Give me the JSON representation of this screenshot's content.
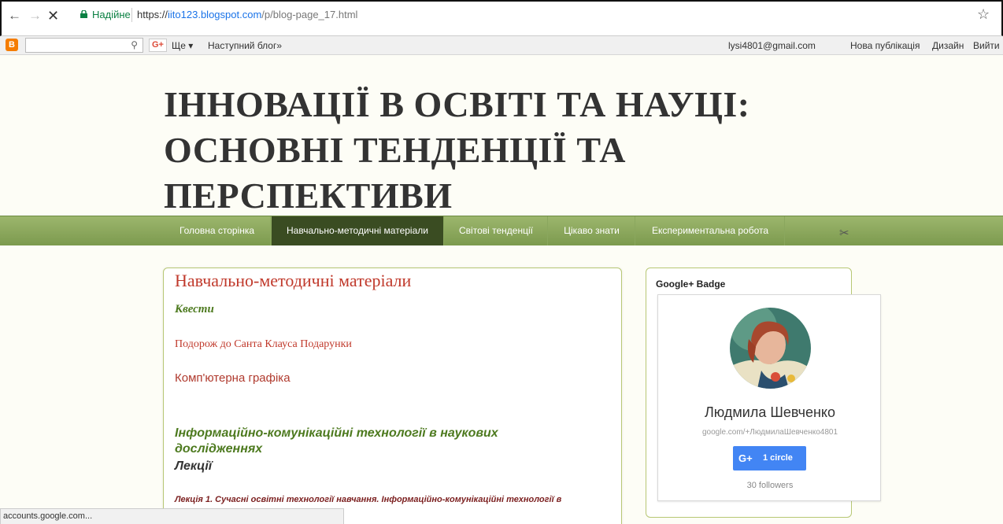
{
  "browser": {
    "secure_label": "Надійне",
    "url_scheme": "https://",
    "url_host": "iito123.blogspot.com",
    "url_path": "/p/blog-page_17.html",
    "status_text": "accounts.google.com..."
  },
  "navbar": {
    "blogger_logo": "B",
    "gplus_label": "G+",
    "more_label": "Ще ▾",
    "next_blog": "Наступний блог»",
    "email": "lysi4801@gmail.com",
    "new_post": "Нова публікація",
    "design": "Дизайн",
    "sign_out": "Вийти"
  },
  "header": {
    "title": "ІННОВАЦІЇ В ОСВІТІ ТА НАУЦІ: ОСНОВНІ ТЕНДЕНЦІЇ ТА ПЕРСПЕКТИВИ"
  },
  "tabs": [
    {
      "label": "Головна сторінка",
      "active": false
    },
    {
      "label": "Навчально-методичні матеріали",
      "active": true
    },
    {
      "label": "Світові тенденції",
      "active": false
    },
    {
      "label": "Цікаво знати",
      "active": false
    },
    {
      "label": "Експериментальна робота",
      "active": false
    }
  ],
  "post": {
    "title": "Навчально-методичні матеріали",
    "quests": "Квести",
    "santa_link": "Подорож до Санта Клауса Подарунки",
    "graphics_link": "Комп'ютерна графіка",
    "ict_heading": "Інформаційно-комунікаційні технології в наукових дослідженнях",
    "lectures": "Лекції",
    "lecture1": "Лекція 1. Сучасні освітні технології навчання. Інформаційно-комунікаційні технології в"
  },
  "sidebar": {
    "gadget_title": "Google+ Badge",
    "badge_name": "Людмила Шевченко",
    "badge_url": "google.com/+ЛюдмилаШевченко4801",
    "circle_button": "1 circle",
    "circle_button_icon": "G+",
    "followers": "30 followers"
  }
}
